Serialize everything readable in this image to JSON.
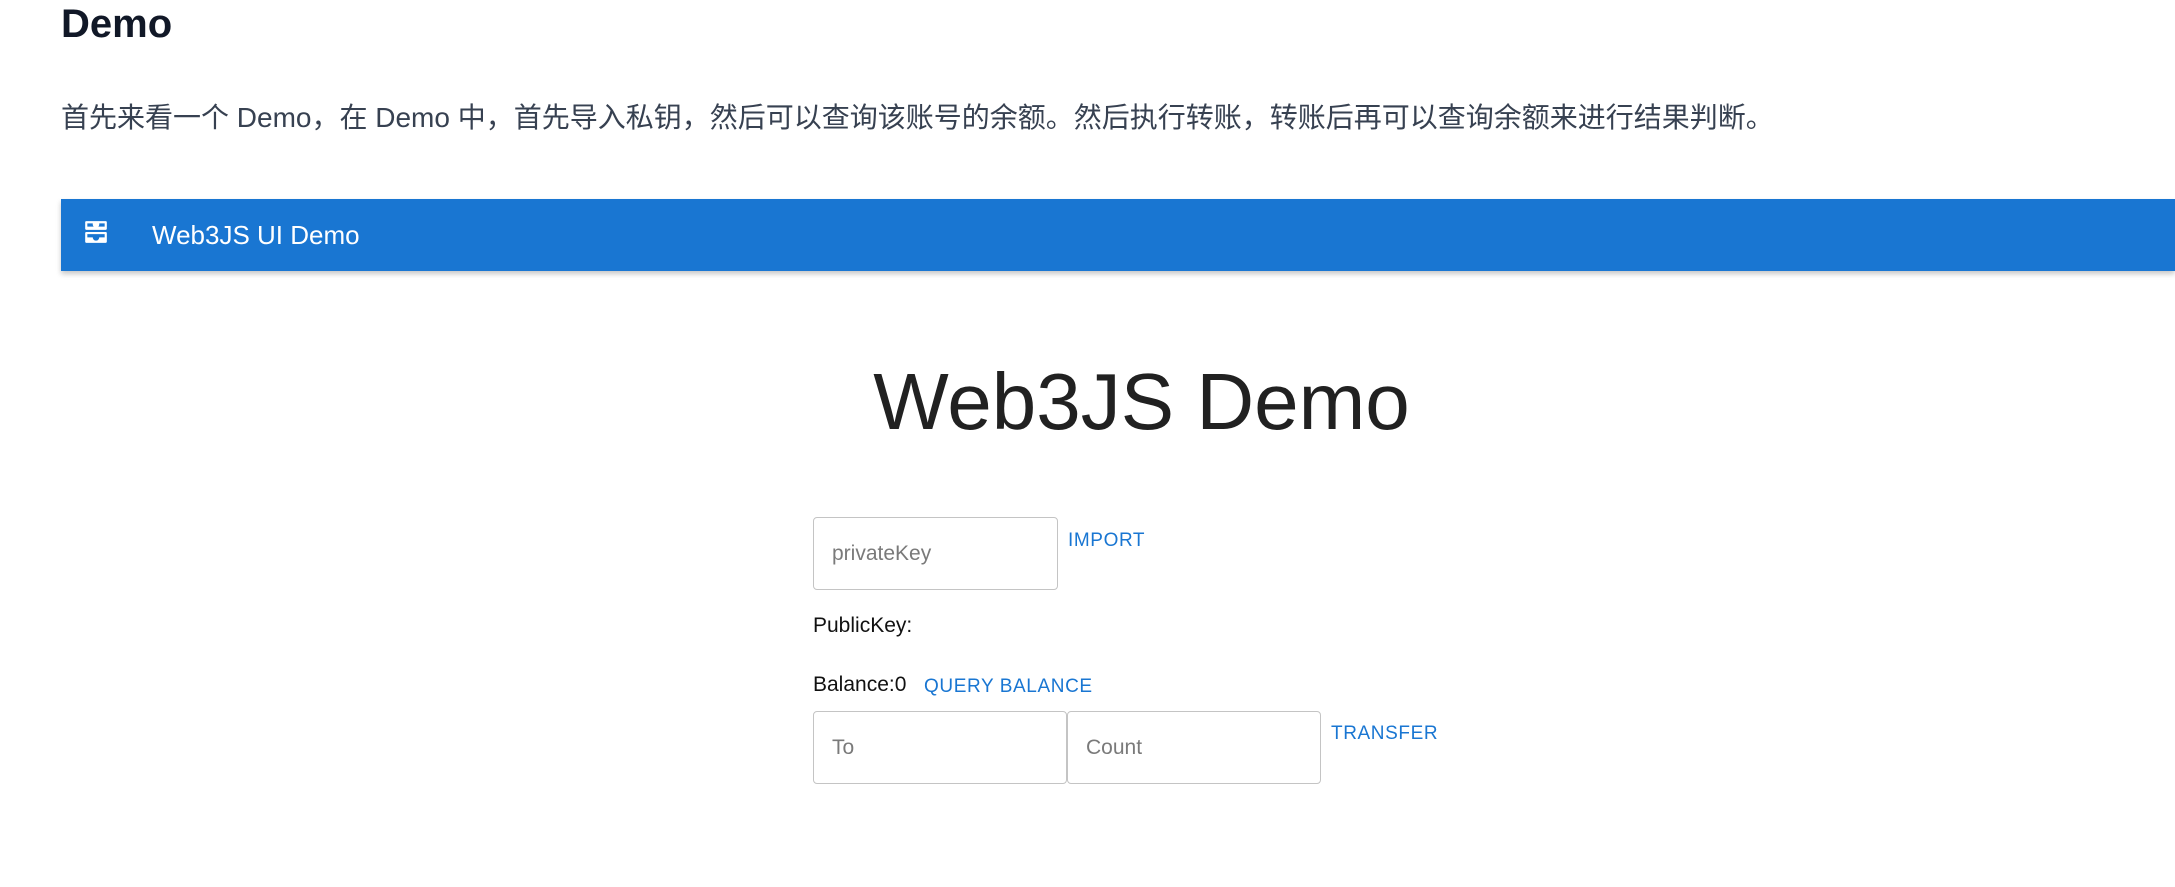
{
  "doc": {
    "title": "Demo",
    "intro": "首先来看一个 Demo，在 Demo 中，首先导入私钥，然后可以查询该账号的余额。然后执行转账，转账后再可以查询余额来进行结果判断。"
  },
  "appbar": {
    "icon": "inbox-tray-icon",
    "title": "Web3JS UI Demo",
    "color": "#1976d2"
  },
  "main": {
    "heading": "Web3JS Demo",
    "private_key_input": {
      "value": "",
      "placeholder": "privateKey"
    },
    "import_button": "IMPORT",
    "public_key_label": "PublicKey:",
    "balance_label": "Balance:0",
    "query_balance_button": "QUERY BALANCE",
    "to_input": {
      "value": "",
      "placeholder": "To"
    },
    "count_input": {
      "value": "",
      "placeholder": "Count"
    },
    "transfer_button": "TRANSFER"
  }
}
